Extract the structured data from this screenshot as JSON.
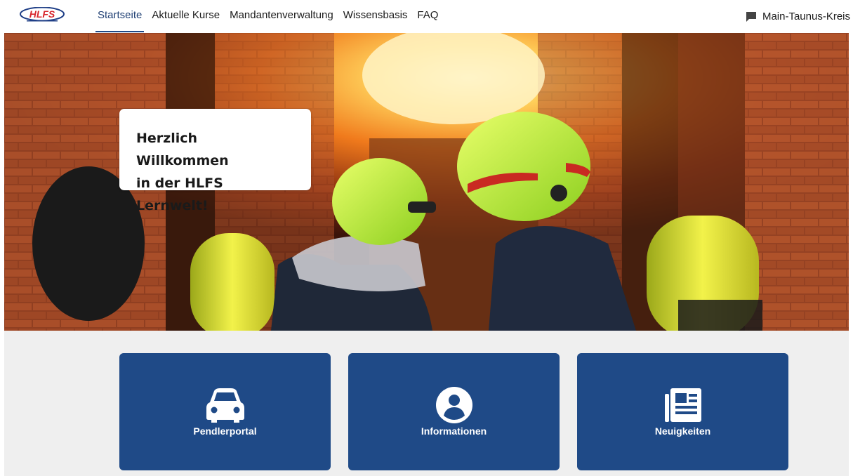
{
  "header": {
    "logo_text": "HLFS",
    "nav": [
      {
        "label": "Startseite",
        "active": true
      },
      {
        "label": "Aktuelle Kurse",
        "active": false
      },
      {
        "label": "Mandantenverwaltung",
        "active": false
      },
      {
        "label": "Wissensbasis",
        "active": false
      },
      {
        "label": "FAQ",
        "active": false
      }
    ],
    "tenant": "Main-Taunus-Kreis",
    "tenant_icon": "chat-bubble-icon"
  },
  "hero": {
    "welcome_line1": "Herzlich Willkommen",
    "welcome_line2": "in der HLFS Lernwelt!"
  },
  "tiles": [
    {
      "label": "Pendlerportal",
      "icon": "car-icon"
    },
    {
      "label": "Informationen",
      "icon": "user-circle-icon"
    },
    {
      "label": "Neuigkeiten",
      "icon": "newspaper-icon"
    }
  ],
  "colors": {
    "brand_blue": "#1f4a87",
    "logo_red": "#d8262c",
    "background_gray": "#efefef"
  }
}
